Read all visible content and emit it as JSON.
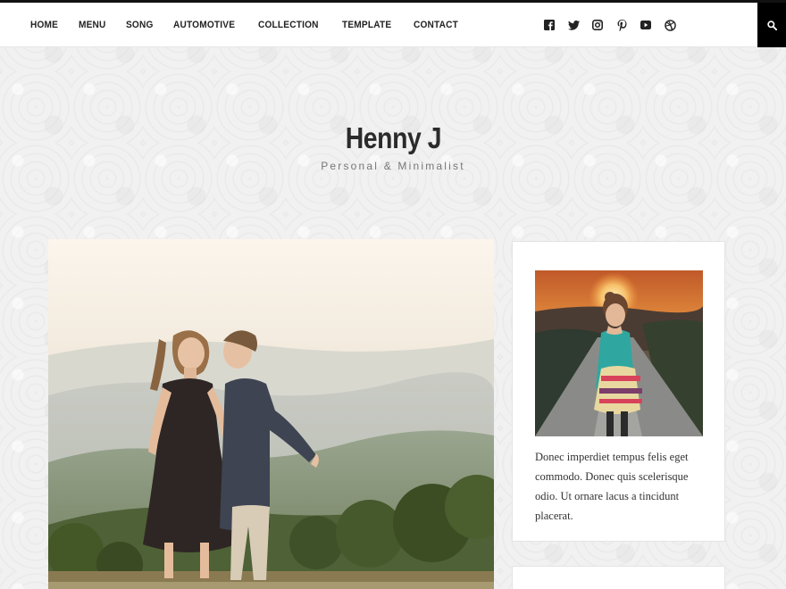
{
  "nav": {
    "items": [
      {
        "label": "HOME"
      },
      {
        "label": "MENU"
      },
      {
        "label": "SONG"
      },
      {
        "label": "AUTOMOTIVE"
      },
      {
        "label": "COLLECTION"
      },
      {
        "label": "TEMPLATE"
      },
      {
        "label": "CONTACT"
      }
    ],
    "social_icons": [
      "facebook-icon",
      "twitter-icon",
      "instagram-icon",
      "pinterest-icon",
      "youtube-icon",
      "dribbble-icon"
    ],
    "search_icon": "search-icon"
  },
  "header": {
    "title": "Henny J",
    "tagline": "Personal & Minimalist"
  },
  "sidebar": {
    "widget": {
      "text": "Donec imperdiet tempus felis eget commodo. Donec quis scelerisque odio. Ut ornare lacus a tincidunt placerat."
    }
  },
  "colors": {
    "accent": "#000000",
    "text": "#222222",
    "tagline": "#777777",
    "background": "#f1f1f1"
  }
}
